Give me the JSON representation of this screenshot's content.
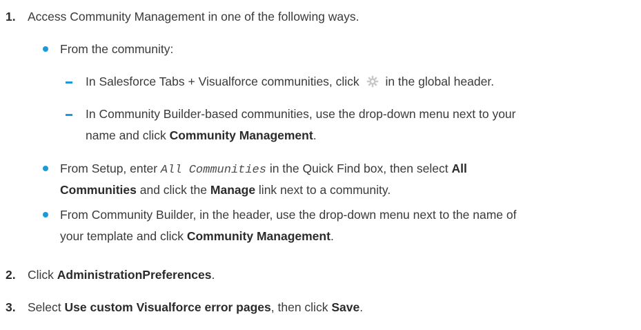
{
  "steps": [
    {
      "number": "1.",
      "text": "Access Community Management in one of the following ways.",
      "items": [
        {
          "text": "From the community:",
          "subitems": [
            {
              "pre": "In Salesforce Tabs + Visualforce communities, click",
              "icon": "gear-icon",
              "post": "in the global header."
            },
            {
              "line1": "In Community Builder-based communities, use the drop-down menu next to your",
              "line2_pre": "name and click",
              "line2_bold": "Community Management",
              "line2_post": "."
            }
          ]
        },
        {
          "pre": "From Setup, enter",
          "code": "All Communities",
          "mid": "in the Quick Find box, then select",
          "bold1": "All",
          "bold1b": "Communities",
          "mid2": "and click the",
          "bold2": "Manage",
          "post": "link next to a community."
        },
        {
          "line1": "From Community Builder, in the header, use the drop-down menu next to the name of",
          "line2_pre": "your template and click",
          "line2_bold": "Community Management",
          "line2_post": "."
        }
      ]
    },
    {
      "number": "2.",
      "pre": "Click",
      "bold": "AdministrationPreferences",
      "post": "."
    },
    {
      "number": "3.",
      "pre": "Select",
      "bold": "Use custom Visualforce error pages",
      "mid": ", then click",
      "bold2": "Save",
      "post": "."
    }
  ],
  "colors": {
    "accent": "#1a9bd7",
    "text": "#3a3a3a"
  }
}
